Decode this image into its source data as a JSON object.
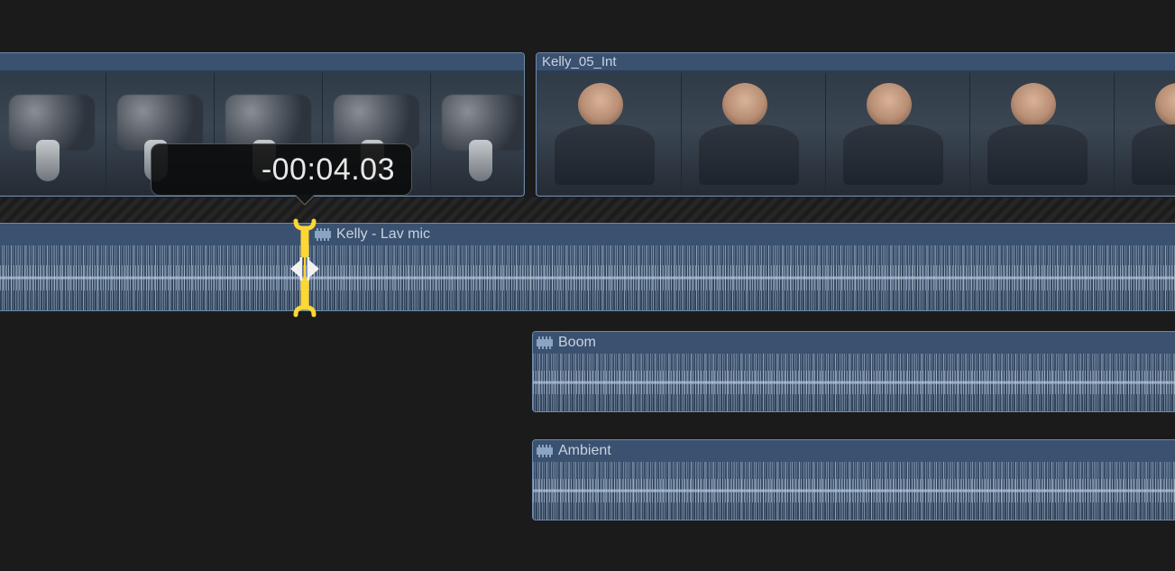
{
  "video": {
    "left_clip_title": "",
    "right_clip_title": "Kelly_05_Int"
  },
  "trim": {
    "delta": "-00:04.03"
  },
  "audio": {
    "lav": {
      "label": "Kelly - Lav mic"
    },
    "boom": {
      "label": "Boom"
    },
    "ambient": {
      "label": "Ambient"
    }
  }
}
